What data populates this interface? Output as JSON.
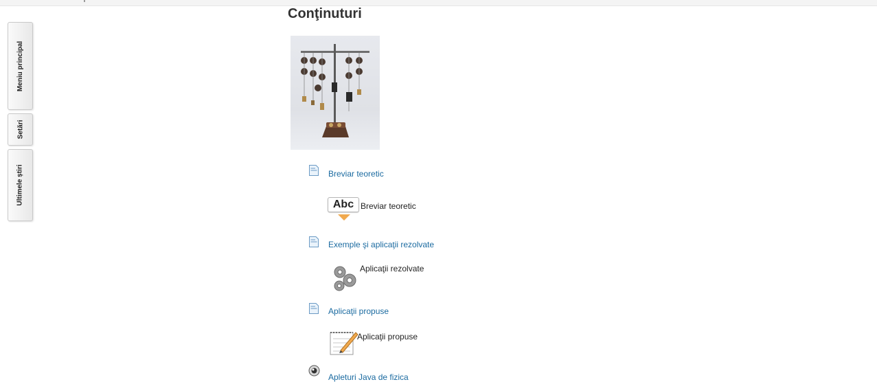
{
  "sidebar": {
    "tabs": [
      {
        "label": "Meniu principal"
      },
      {
        "label": "Setări"
      },
      {
        "label": "Ultimele știri"
      }
    ]
  },
  "main": {
    "title": "Conţinuturi",
    "sections": [
      {
        "link": "Breviar teoretic",
        "activity": "Breviar teoretic",
        "activity_icon": "abc-label-icon"
      },
      {
        "link": "Exemple şi aplicaţii rezolvate",
        "activity": "Aplicaţii rezolvate",
        "activity_icon": "gears-icon"
      },
      {
        "link": "Aplicaţii propuse",
        "activity": "Aplicaţii propuse",
        "activity_icon": "notepad-pencil-icon"
      },
      {
        "link": "Apleturi Java de fizica",
        "link_icon": "java-applet-icon"
      }
    ]
  },
  "colors": {
    "link": "#1a6aa0",
    "title": "#333333",
    "abc_arrow": "#f0a94e"
  }
}
